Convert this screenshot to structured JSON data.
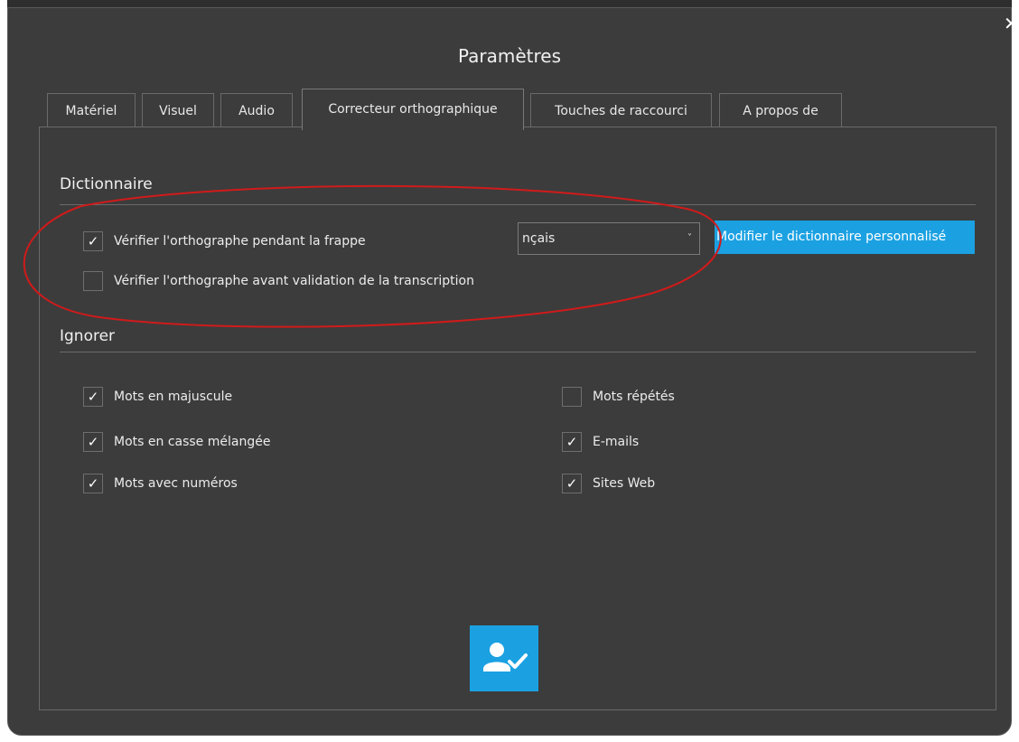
{
  "window": {
    "title": "Paramètres",
    "close_glyph": "✕"
  },
  "tabs": [
    {
      "label": "Matériel",
      "active": false
    },
    {
      "label": "Visuel",
      "active": false
    },
    {
      "label": "Audio",
      "active": false
    },
    {
      "label": "Correcteur orthographique",
      "active": true
    },
    {
      "label": "Touches de raccourci",
      "active": false
    },
    {
      "label": "A propos de",
      "active": false
    }
  ],
  "dictionary": {
    "section_title": "Dictionnaire",
    "check_while_typing": {
      "label": "Vérifier l'orthographe pendant la frappe",
      "checked": true
    },
    "check_before_validation": {
      "label": "Vérifier l'orthographe avant validation de la transcription",
      "checked": false
    },
    "language_select": {
      "value": "nçais",
      "arrow": "˅"
    },
    "edit_custom_button": "Modifier le dictionnaire personnalisé"
  },
  "ignore": {
    "section_title": "Ignorer",
    "options": [
      {
        "label": "Mots en majuscule",
        "checked": true
      },
      {
        "label": "Mots en casse mélangée",
        "checked": true
      },
      {
        "label": "Mots avec numéros",
        "checked": true
      },
      {
        "label": "Mots répétés",
        "checked": false
      },
      {
        "label": "E-mails",
        "checked": true
      },
      {
        "label": "Sites Web",
        "checked": true
      }
    ]
  },
  "check_glyph": "✓",
  "colors": {
    "background": "#3c3c3c",
    "accent": "#1ba1e2",
    "annotation": "#d11a1a"
  },
  "icons": {
    "apply_button_icon": "user-check-icon",
    "close_icon": "close-icon"
  }
}
